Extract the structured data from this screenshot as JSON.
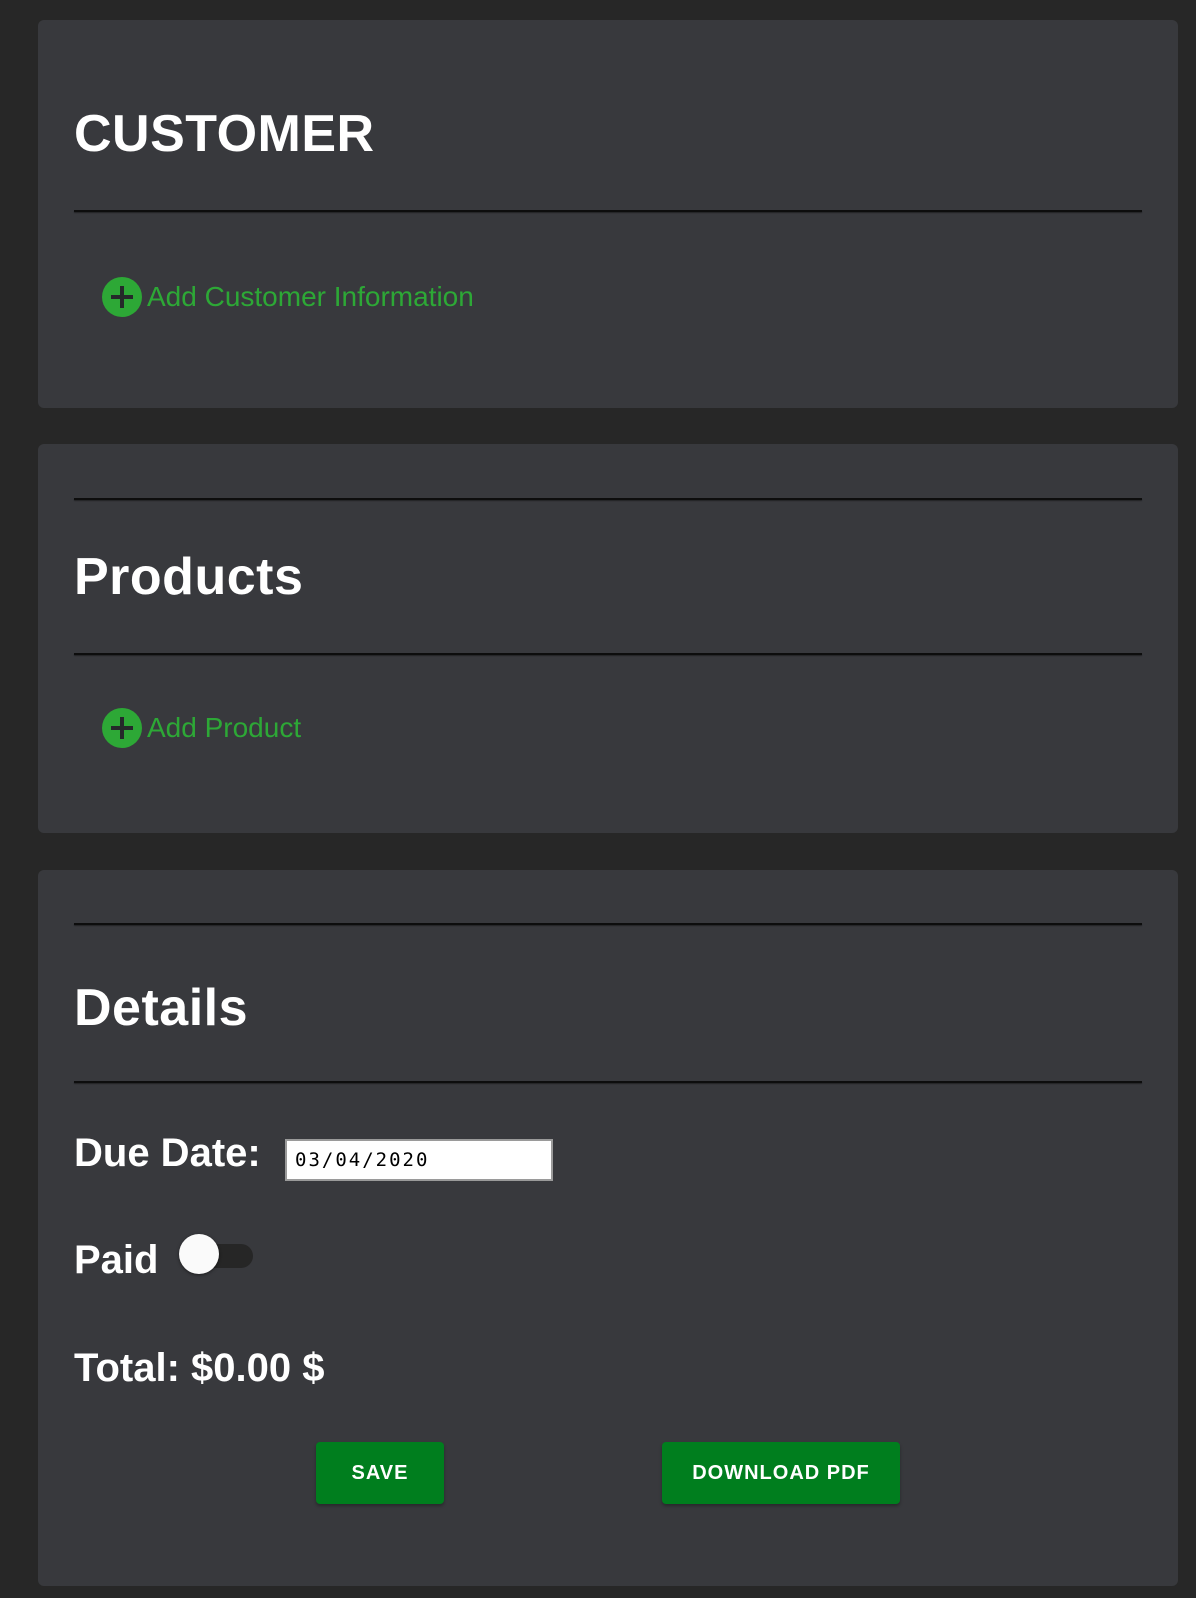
{
  "customer": {
    "title": "CUSTOMER",
    "add_label": "Add Customer Information"
  },
  "products": {
    "title": "Products",
    "add_label": "Add Product"
  },
  "details": {
    "title": "Details",
    "due_date_label": "Due Date:",
    "due_date_value": "03/04/2020",
    "paid_label": "Paid",
    "paid": false,
    "total_label": "Total: $0.00 $",
    "save_label": "SAVE",
    "download_label": "DOWNLOAD PDF"
  },
  "colors": {
    "page_bg": "#272727",
    "card_bg": "#38393d",
    "accent_green": "#2da836",
    "button_green": "#007e1e"
  }
}
